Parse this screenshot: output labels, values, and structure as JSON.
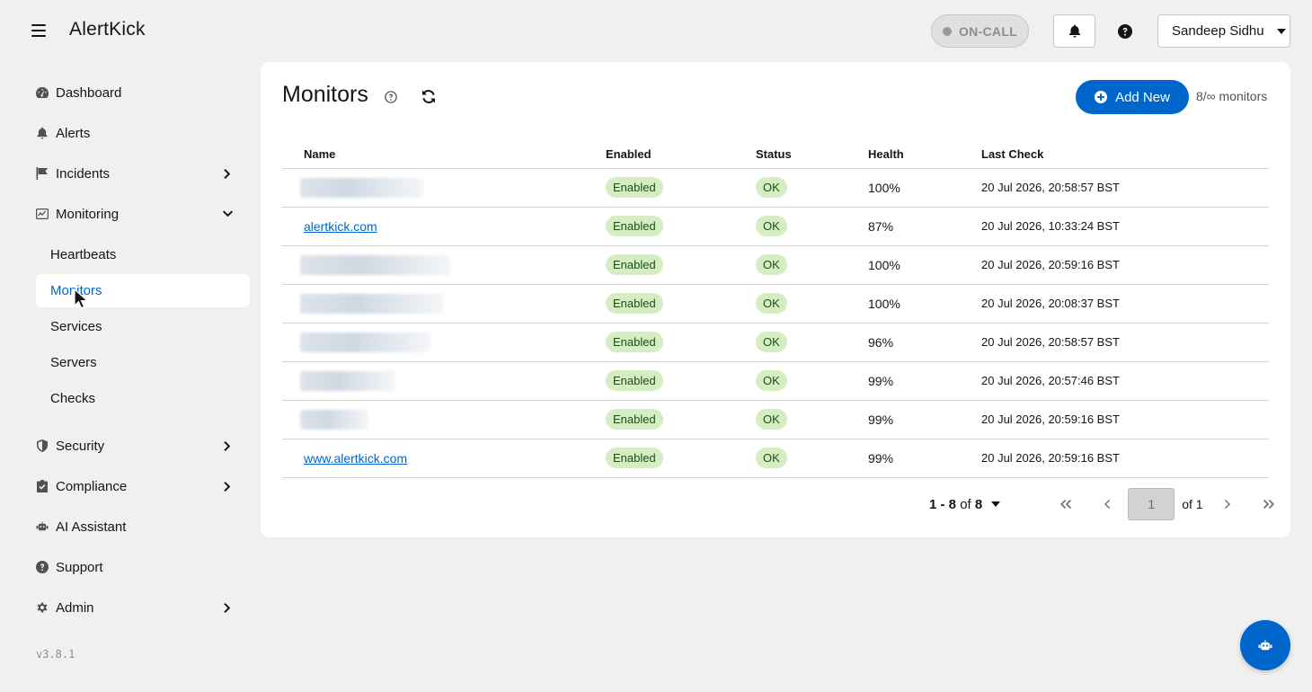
{
  "app": {
    "title": "AlertKick",
    "version": "v3.8.1"
  },
  "header": {
    "oncall_label": "ON-CALL",
    "user_name": "Sandeep Sidhu",
    "icons": [
      "menu-icon",
      "bell-icon",
      "help-icon",
      "caret-down-icon"
    ]
  },
  "sidebar": {
    "items": [
      {
        "label": "Dashboard",
        "icon": "dashboard-icon"
      },
      {
        "label": "Alerts",
        "icon": "bell-icon"
      },
      {
        "label": "Incidents",
        "icon": "flag-icon",
        "expandable": true
      },
      {
        "label": "Monitoring",
        "icon": "monitor-icon",
        "expanded": true
      },
      {
        "label": "Security",
        "icon": "shield-icon",
        "expandable": true
      },
      {
        "label": "Compliance",
        "icon": "clipboard-check-icon",
        "expandable": true
      },
      {
        "label": "AI Assistant",
        "icon": "robot-icon"
      },
      {
        "label": "Support",
        "icon": "question-icon"
      },
      {
        "label": "Admin",
        "icon": "gear-icon",
        "expandable": true
      }
    ],
    "monitoring_sub": [
      {
        "label": "Heartbeats"
      },
      {
        "label": "Monitors",
        "active": true
      },
      {
        "label": "Services"
      },
      {
        "label": "Servers"
      },
      {
        "label": "Checks"
      }
    ]
  },
  "main": {
    "title": "Monitors",
    "add_button": "Add New",
    "count": "8/∞ monitors",
    "columns": [
      "Name",
      "Enabled",
      "Status",
      "Health",
      "Last Check"
    ],
    "rows": [
      {
        "name": "",
        "redacted": true,
        "enabled": "Enabled",
        "status": "OK",
        "health": "100%",
        "last_check": "20 Jul 2026, 20:58:57 BST"
      },
      {
        "name": "alertkick.com",
        "redacted": false,
        "enabled": "Enabled",
        "status": "OK",
        "health": "87%",
        "last_check": "20 Jul 2026, 10:33:24 BST"
      },
      {
        "name": "",
        "redacted": true,
        "enabled": "Enabled",
        "status": "OK",
        "health": "100%",
        "last_check": "20 Jul 2026, 20:59:16 BST"
      },
      {
        "name": "",
        "redacted": true,
        "enabled": "Enabled",
        "status": "OK",
        "health": "100%",
        "last_check": "20 Jul 2026, 20:08:37 BST"
      },
      {
        "name": "",
        "redacted": true,
        "enabled": "Enabled",
        "status": "OK",
        "health": "96%",
        "last_check": "20 Jul 2026, 20:58:57 BST"
      },
      {
        "name": "",
        "redacted": true,
        "enabled": "Enabled",
        "status": "OK",
        "health": "99%",
        "last_check": "20 Jul 2026, 20:57:46 BST"
      },
      {
        "name": "",
        "redacted": true,
        "enabled": "Enabled",
        "status": "OK",
        "health": "99%",
        "last_check": "20 Jul 2026, 20:59:16 BST"
      },
      {
        "name": "www.alertkick.com",
        "redacted": false,
        "enabled": "Enabled",
        "status": "OK",
        "health": "99%",
        "last_check": "20 Jul 2026, 20:59:16 BST"
      }
    ],
    "pagination": {
      "range": "1 - 8",
      "of_word": "of",
      "total": "8",
      "current_page": "1",
      "page_of": "of 1"
    }
  },
  "colors": {
    "accent": "#0066cc",
    "pill_green": "#d4edc3",
    "pill_text": "#1e4f18",
    "background": "#f0f0f0"
  }
}
